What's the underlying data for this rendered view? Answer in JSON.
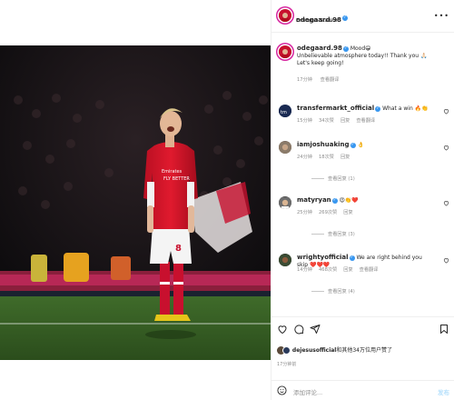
{
  "post": {
    "author": "odegaard.98",
    "location": "Emirates Stadium",
    "caption_author": "odegaard.98",
    "caption_text": "Mood😁",
    "caption_body": "Unbelievable atmosphere today!! Thank you 🙏🏻",
    "caption_body2": "Let's keep going!",
    "caption_age": "17分钟",
    "caption_translate": "查看翻译"
  },
  "comments": [
    {
      "user": "transfermarkt_official",
      "text": "What a win 🔥👏",
      "age": "15分钟",
      "likes": "34次赞",
      "reply": "回复",
      "translate": "查看翻译",
      "replies": ""
    },
    {
      "user": "iamjoshuaking",
      "text": "👌",
      "age": "24分钟",
      "likes": "18次赞",
      "reply": "回复",
      "translate": "",
      "replies": "查看回复 (1)"
    },
    {
      "user": "matyryan",
      "text": "😍👏❤️",
      "age": "25分钟",
      "likes": "269次赞",
      "reply": "回复",
      "translate": "",
      "replies": "查看回复 (3)"
    },
    {
      "user": "wrightyofficial",
      "text": "We are right behind you skip ❤️❤️❤️",
      "age": "14分钟",
      "likes": "468次赞",
      "reply": "回复",
      "translate": "查看翻译",
      "replies": "查看回复 (4)"
    }
  ],
  "likes": {
    "prefix": "dejesusofficial",
    "suffix": "和其他34万位用户赞了"
  },
  "time_ago": "17分钟前",
  "add_comment": {
    "placeholder": "添加评论...",
    "post": "发布"
  },
  "colors": {
    "accent": "#3897f0",
    "arsenal_red": "#c8102e"
  },
  "icons": [
    "more-icon",
    "verified-icon",
    "heart-icon",
    "comment-icon",
    "share-icon",
    "bookmark-icon",
    "emoji-icon"
  ]
}
